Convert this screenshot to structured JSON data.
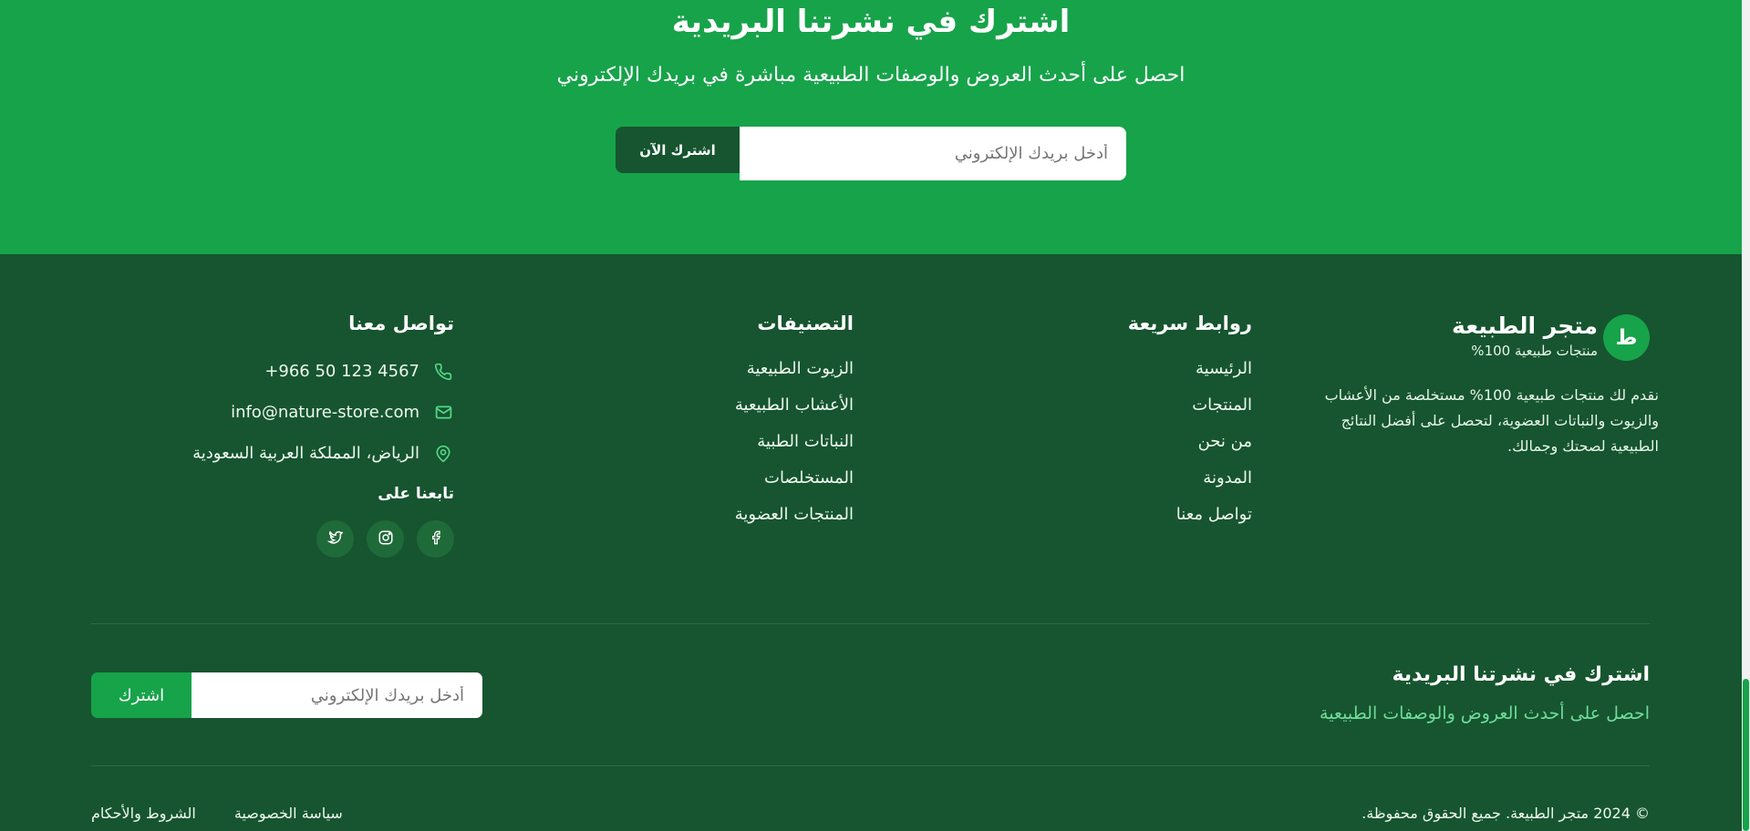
{
  "hero": {
    "title": "اشترك في نشرتنا البريدية",
    "subtitle": "احصل على أحدث العروض والوصفات الطبيعية مباشرة في بريدك الإلكتروني",
    "email_placeholder": "أدخل بريدك الإلكتروني",
    "subscribe_label": "اشترك الآن"
  },
  "brand": {
    "mark": "ط",
    "name": "متجر الطبيعة",
    "tagline": "منتجات طبيعية 100%",
    "description": "نقدم لك منتجات طبيعية 100% مستخلصة من الأعشاب والزيوت والنباتات العضوية، لتحصل على أفضل النتائج الطبيعية لصحتك وجمالك."
  },
  "quick_links": {
    "title": "روابط سريعة",
    "items": [
      "الرئيسية",
      "المنتجات",
      "من نحن",
      "المدونة",
      "تواصل معنا"
    ]
  },
  "categories": {
    "title": "التصنيفات",
    "items": [
      "الزيوت الطبيعية",
      "الأعشاب الطبيعية",
      "النباتات الطبية",
      "المستخلصات",
      "المنتجات العضوية"
    ]
  },
  "contact": {
    "title": "تواصل معنا",
    "phone": "+966 50 123 4567",
    "email": "info@nature-store.com",
    "address": "الرياض، المملكة العربية السعودية",
    "follow_label": "تابعنا على"
  },
  "footer_newsletter": {
    "title": "اشترك في نشرتنا البريدية",
    "text": "احصل على أحدث العروض والوصفات الطبيعية",
    "email_placeholder": "أدخل بريدك الإلكتروني",
    "subscribe_label": "اشترك"
  },
  "bottom": {
    "copyright": "© 2024 متجر الطبيعة. جميع الحقوق محفوظة.",
    "privacy": "سياسة الخصوصية",
    "terms": "الشروط والأحكام"
  },
  "icons": [
    "phone-icon",
    "mail-icon",
    "location-icon",
    "facebook-icon",
    "instagram-icon",
    "twitter-icon"
  ]
}
